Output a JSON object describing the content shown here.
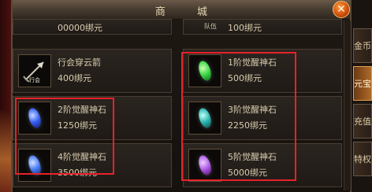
{
  "window": {
    "title": "商 城"
  },
  "top_row": {
    "left_price": "00000绑元",
    "right_tag": "队伍",
    "right_price": "100绑元"
  },
  "items": [
    {
      "name": "行会穿云箭",
      "price": "400绑元",
      "icon": "guild-arrow-icon",
      "tag": "行会",
      "color": ""
    },
    {
      "name": "1阶觉醒神石",
      "price": "500绑元",
      "icon": "green-gem-icon",
      "color": "#3ed84a"
    },
    {
      "name": "2阶觉醒神石",
      "price": "1250绑元",
      "icon": "blue-gem-icon",
      "color": "#3a63f5"
    },
    {
      "name": "3阶觉醒神石",
      "price": "2250绑元",
      "icon": "teal-gem-icon",
      "color": "#2fb7b2"
    },
    {
      "name": "4阶觉醒神石",
      "price": "3500绑元",
      "icon": "blue-gem-icon",
      "color": "#4a7ef5"
    },
    {
      "name": "5阶觉醒神石",
      "price": "5000绑元",
      "icon": "purple-gem-icon",
      "color": "#b05ee6"
    }
  ],
  "side_tabs": [
    {
      "label": "金币",
      "active": false
    },
    {
      "label": "元宝",
      "active": true
    },
    {
      "label": "充值",
      "active": false
    },
    {
      "label": "特权",
      "active": false
    }
  ],
  "colors": {
    "highlight": "#e8212a",
    "title_text": "#e6d8b4",
    "item_text": "#d8ccae"
  }
}
